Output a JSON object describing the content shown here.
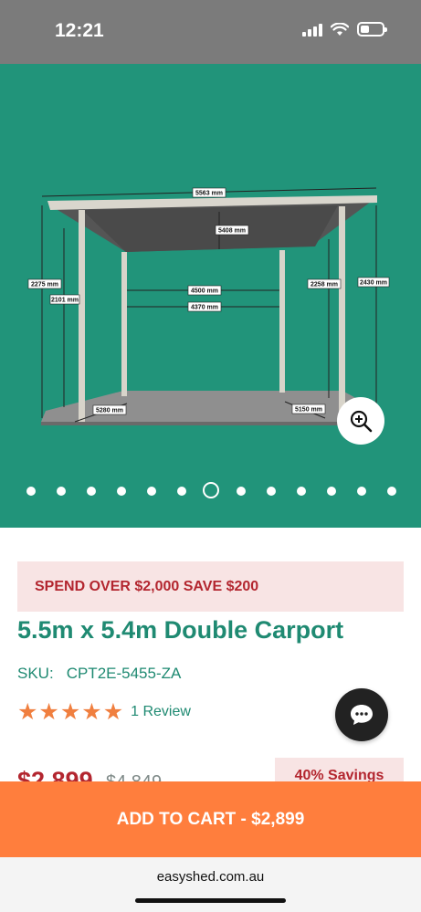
{
  "status_bar": {
    "time": "12:21",
    "signal_icon": "cellular-signal-icon",
    "wifi_icon": "wifi-icon",
    "battery_icon": "battery-icon"
  },
  "gallery": {
    "dimensions": {
      "top_length": "5563 mm",
      "roof_depth": "5408 mm",
      "left_outer_height": "2275 mm",
      "left_inner_height": "2101 mm",
      "post_span_rear": "4500 mm",
      "post_span_front": "4370 mm",
      "right_inner_height": "2258 mm",
      "right_outer_height": "2430 mm",
      "base_left": "5280 mm",
      "base_right": "5150 mm"
    },
    "zoom_icon": "zoom-in-icon",
    "slide_count": 13,
    "active_slide": 7,
    "background_color": "#21947a"
  },
  "promo": {
    "text": "SPEND OVER $2,000 SAVE $200"
  },
  "product": {
    "title": "5.5m x 5.4m Double Carport",
    "sku_label": "SKU:",
    "sku_value": "CPT2E-5455-ZA",
    "rating": 5,
    "rating_max": 5,
    "reviews": "1 Review",
    "price": "$2,899",
    "was_price": "$4,849",
    "savings": "40% Savings"
  },
  "chat": {
    "icon": "chat-bubble-icon"
  },
  "cart_button": {
    "label": "ADD TO CART - $2,899"
  },
  "browser": {
    "url": "easyshed.com.au"
  },
  "colors": {
    "brand_green": "#1f8a72",
    "accent_orange": "#ff7e3d",
    "promo_red": "#b3262f",
    "star_orange": "#f07f3f"
  }
}
